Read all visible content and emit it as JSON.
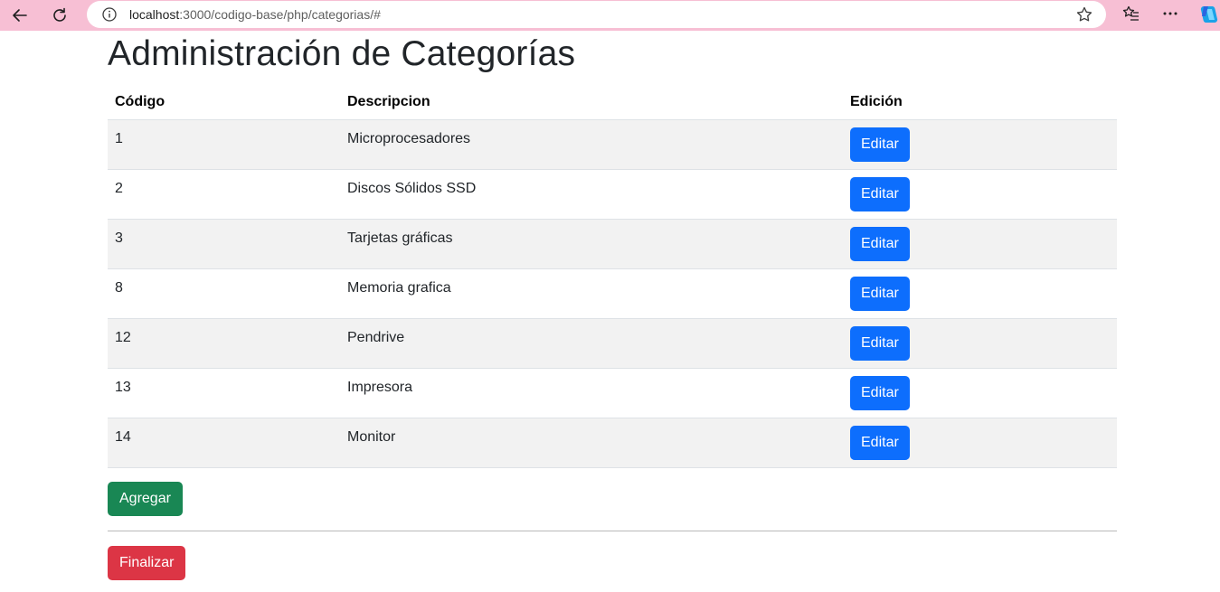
{
  "browser": {
    "url_host": "localhost",
    "url_rest": ":3000/codigo-base/php/categorias/#"
  },
  "page": {
    "title": "Administración de Categorías"
  },
  "table": {
    "headers": [
      "Código",
      "Descripcion",
      "Edición"
    ],
    "rows": [
      {
        "code": "1",
        "description": "Microprocesadores",
        "action": "Editar"
      },
      {
        "code": "2",
        "description": "Discos Sólidos SSD",
        "action": "Editar"
      },
      {
        "code": "3",
        "description": "Tarjetas gráficas",
        "action": "Editar"
      },
      {
        "code": "8",
        "description": "Memoria grafica",
        "action": "Editar"
      },
      {
        "code": "12",
        "description": "Pendrive",
        "action": "Editar"
      },
      {
        "code": "13",
        "description": "Impresora",
        "action": "Editar"
      },
      {
        "code": "14",
        "description": "Monitor",
        "action": "Editar"
      }
    ]
  },
  "actions": {
    "add_label": "Agregar",
    "finish_label": "Finalizar"
  },
  "colors": {
    "browser_bar": "#f7bfd4",
    "primary": "#0d6efd",
    "success": "#198754",
    "danger": "#dc3545"
  }
}
